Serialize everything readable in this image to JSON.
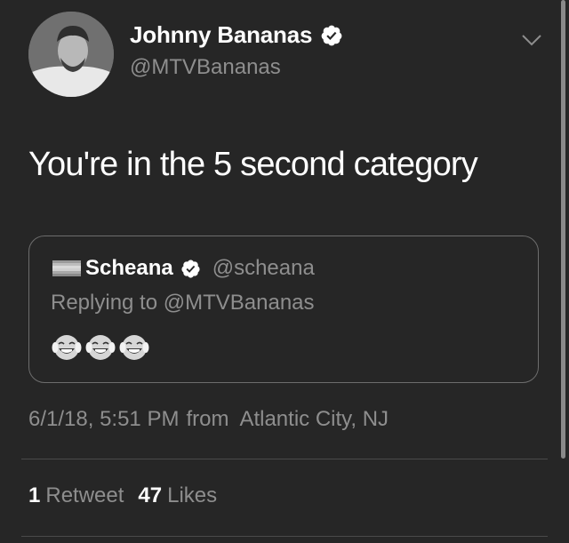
{
  "tweet": {
    "author_name": "Johnny Bananas",
    "author_handle": "@MTVBananas",
    "text": "You're in the 5 second category",
    "timestamp": "6/1/18, 5:51 PM",
    "from_label": "from",
    "location": "Atlantic City, NJ",
    "retweets_count": "1",
    "retweets_label": "Retweet",
    "likes_count": "47",
    "likes_label": "Likes"
  },
  "quoted_tweet": {
    "author_name": "Scheana",
    "author_handle": "@scheana",
    "replying_to": "Replying to @MTVBananas",
    "emojis": [
      "face-with-tears-of-joy",
      "face-with-tears-of-joy",
      "face-with-tears-of-joy"
    ]
  },
  "icons": {
    "verified": "verified-badge-icon",
    "menu": "chevron-down-icon",
    "flag": "flag-icon"
  },
  "colors": {
    "background": "#262626",
    "primary_text": "#ffffff",
    "secondary_text": "#8e8e8e",
    "border": "#6d6d6d"
  }
}
